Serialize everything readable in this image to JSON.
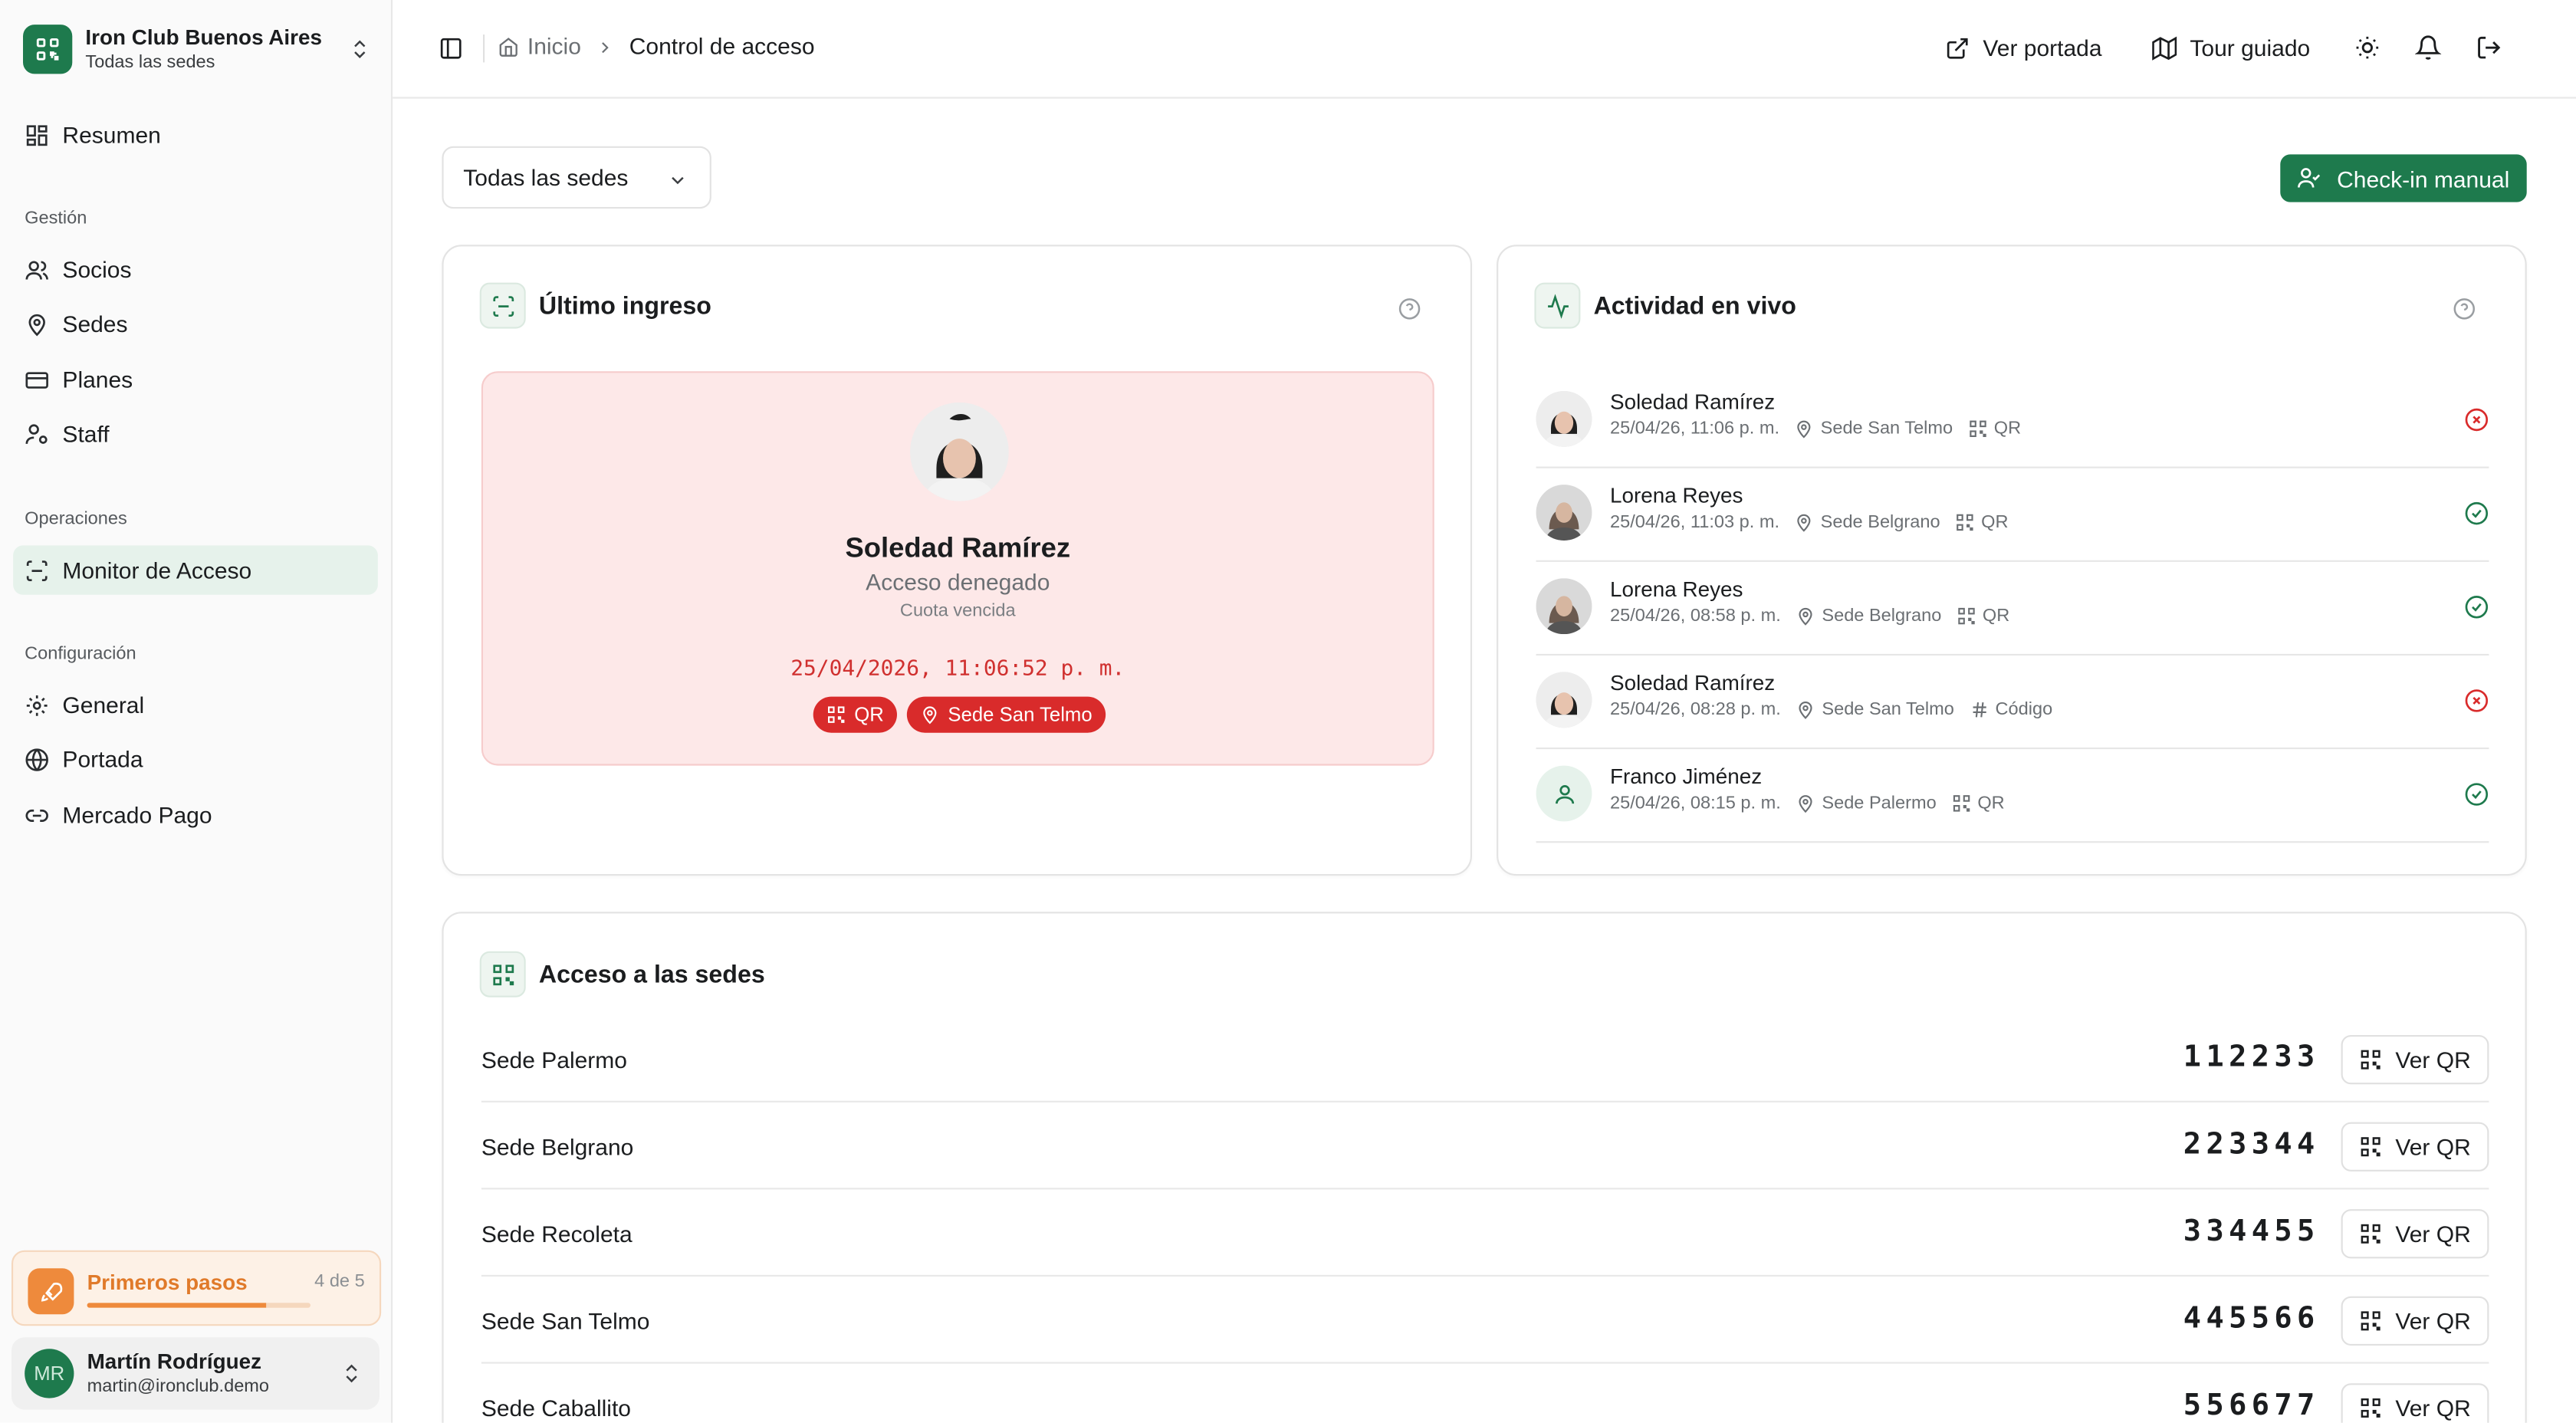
{
  "org": {
    "name": "Iron Club Buenos Aires",
    "subtitle": "Todas las sedes"
  },
  "sidebar": {
    "summary": "Resumen",
    "sections": {
      "gestion": "Gestión",
      "operaciones": "Operaciones",
      "configuracion": "Configuración"
    },
    "items": {
      "socios": "Socios",
      "sedes": "Sedes",
      "planes": "Planes",
      "staff": "Staff",
      "monitor": "Monitor de Acceso",
      "general": "General",
      "portada": "Portada",
      "mercado_pago": "Mercado Pago"
    },
    "onboarding": {
      "title": "Primeros pasos",
      "count": "4 de 5",
      "progress": 0.8
    },
    "user": {
      "initials": "MR",
      "name": "Martín Rodríguez",
      "email": "martin@ironclub.demo"
    }
  },
  "topbar": {
    "breadcrumb": {
      "home": "Inicio",
      "current": "Control de acceso"
    },
    "view_portal": "Ver portada",
    "guided_tour": "Tour guiado"
  },
  "main": {
    "site_filter": "Todas las sedes",
    "checkin_button": "Check-in manual",
    "last_entry": {
      "title": "Último ingreso",
      "name": "Soledad Ramírez",
      "status": "Acceso denegado",
      "reason": "Cuota vencida",
      "timestamp": "25/04/2026, 11:06:52 p. m.",
      "method": "QR",
      "site": "Sede San Telmo"
    },
    "live_activity": {
      "title": "Actividad en vivo",
      "items": [
        {
          "name": "Soledad Ramírez",
          "time": "25/04/26, 11:06 p. m.",
          "site": "Sede San Telmo",
          "method": "QR",
          "status": "denied"
        },
        {
          "name": "Lorena Reyes",
          "time": "25/04/26, 11:03 p. m.",
          "site": "Sede Belgrano",
          "method": "QR",
          "status": "granted"
        },
        {
          "name": "Lorena Reyes",
          "time": "25/04/26, 08:58 p. m.",
          "site": "Sede Belgrano",
          "method": "QR",
          "status": "granted"
        },
        {
          "name": "Soledad Ramírez",
          "time": "25/04/26, 08:28 p. m.",
          "site": "Sede San Telmo",
          "method": "Código",
          "status": "denied"
        },
        {
          "name": "Franco Jiménez",
          "time": "25/04/26, 08:15 p. m.",
          "site": "Sede Palermo",
          "method": "QR",
          "status": "granted"
        }
      ]
    },
    "site_access": {
      "title": "Acceso a las sedes",
      "button_label": "Ver QR",
      "sites": [
        {
          "name": "Sede Palermo",
          "code": "112233"
        },
        {
          "name": "Sede Belgrano",
          "code": "223344"
        },
        {
          "name": "Sede Recoleta",
          "code": "334455"
        },
        {
          "name": "Sede San Telmo",
          "code": "445566"
        },
        {
          "name": "Sede Caballito",
          "code": "556677"
        }
      ]
    }
  },
  "colors": {
    "brand": "#1e7a4d",
    "denied": "#d92b2b",
    "granted": "#1e7a4d",
    "onboarding": "#ee8a3c"
  }
}
